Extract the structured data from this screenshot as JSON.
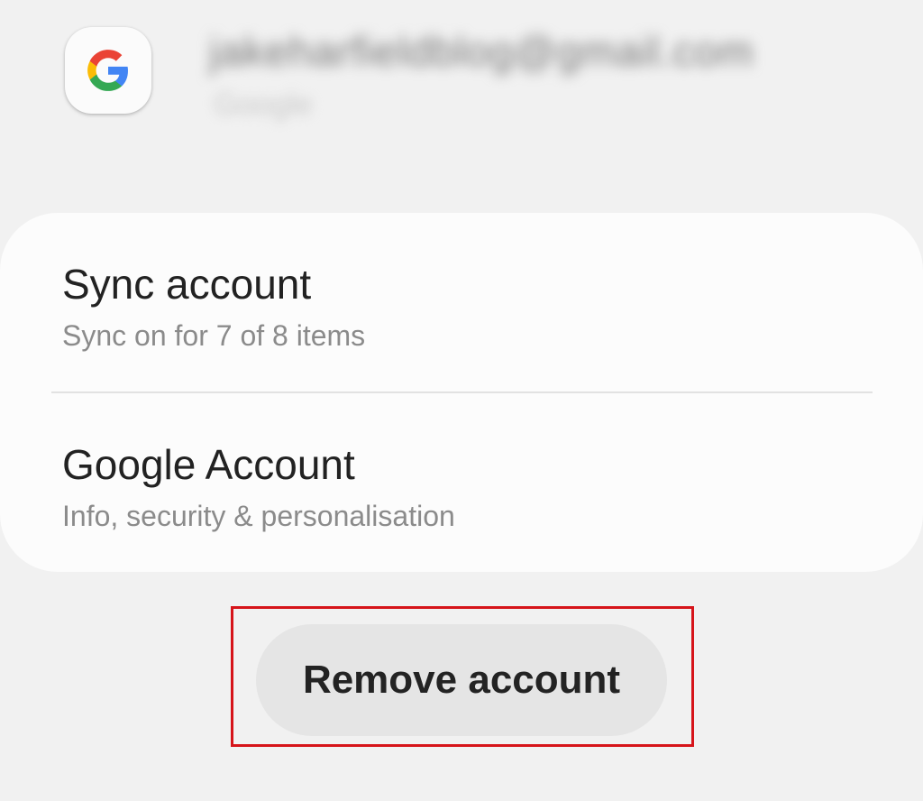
{
  "account": {
    "email": "jakeharfieldblog@gmail.com",
    "type": "Google",
    "icon": "google-g-logo",
    "logo_colors": {
      "blue": "#4285F4",
      "red": "#EA4335",
      "yellow": "#FBBC05",
      "green": "#34A853"
    }
  },
  "options": {
    "sync": {
      "title": "Sync account",
      "subtitle": "Sync on for 7 of 8 items"
    },
    "google_account": {
      "title": "Google Account",
      "subtitle": "Info, security & personalisation"
    }
  },
  "actions": {
    "remove_label": "Remove account",
    "highlight_color": "#d6141a"
  }
}
